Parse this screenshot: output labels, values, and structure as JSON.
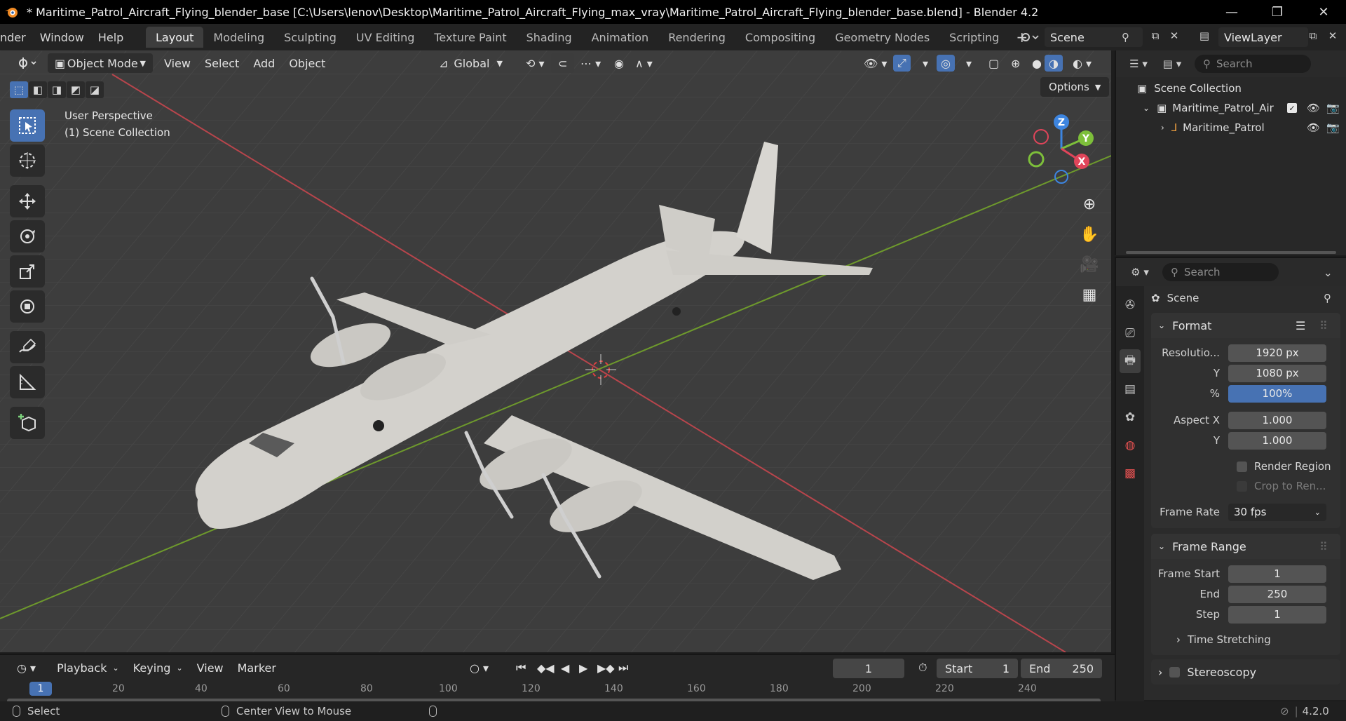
{
  "window": {
    "title": "* Maritime_Patrol_Aircraft_Flying_blender_base [C:\\Users\\lenov\\Desktop\\Maritime_Patrol_Aircraft_Flying_max_vray\\Maritime_Patrol_Aircraft_Flying_blender_base.blend] - Blender 4.2",
    "minimize": "—",
    "restore": "❐",
    "close": "✕"
  },
  "menu": {
    "render": "nder",
    "window": "Window",
    "help": "Help"
  },
  "workspaces": [
    "Layout",
    "Modeling",
    "Sculpting",
    "UV Editing",
    "Texture Paint",
    "Shading",
    "Animation",
    "Rendering",
    "Compositing",
    "Geometry Nodes",
    "Scripting"
  ],
  "workspace_add": "+",
  "scene": {
    "name": "Scene",
    "viewlayer": "ViewLayer"
  },
  "viewport_header": {
    "mode": "Object Mode",
    "view": "View",
    "select": "Select",
    "add": "Add",
    "object": "Object",
    "transform_orientation": "Global",
    "options": "Options"
  },
  "viewport": {
    "perspective_label": "User Perspective",
    "collection_label": "(1) Scene Collection",
    "gizmo": {
      "z": "Z",
      "y": "Y",
      "x": "X"
    }
  },
  "outliner": {
    "search_placeholder": "Search",
    "root": "Scene Collection",
    "collection": "Maritime_Patrol_Air",
    "object": "Maritime_Patrol"
  },
  "properties": {
    "search_placeholder": "Search",
    "context": "Scene",
    "format_panel": "Format",
    "resolution_x_label": "Resolutio...",
    "resolution_x": "1920 px",
    "resolution_y_label": "Y",
    "resolution_y": "1080 px",
    "percent_label": "%",
    "percent": "100%",
    "aspect_x_label": "Aspect X",
    "aspect_x": "1.000",
    "aspect_y_label": "Y",
    "aspect_y": "1.000",
    "render_region": "Render Region",
    "crop": "Crop to Ren...",
    "frame_rate_label": "Frame Rate",
    "frame_rate": "30 fps",
    "frame_range_panel": "Frame Range",
    "frame_start_label": "Frame Start",
    "frame_start": "1",
    "end_label": "End",
    "end": "250",
    "step_label": "Step",
    "step": "1",
    "time_stretching": "Time Stretching",
    "stereoscopy": "Stereoscopy"
  },
  "timeline": {
    "playback": "Playback",
    "keying": "Keying",
    "view": "View",
    "marker": "Marker",
    "current_frame": "1",
    "start_label": "Start",
    "start": "1",
    "end_label": "End",
    "end": "250",
    "ruler": [
      "20",
      "40",
      "60",
      "80",
      "100",
      "120",
      "140",
      "160",
      "180",
      "200",
      "220",
      "240"
    ],
    "playhead": "1"
  },
  "statusbar": {
    "select": "Select",
    "center_view": "Center View to Mouse",
    "version": "4.2.0"
  },
  "colors": {
    "accent": "#4772b3",
    "axis_x": "#e0455a",
    "axis_y": "#7dbf3a",
    "axis_z": "#3d85e0"
  }
}
